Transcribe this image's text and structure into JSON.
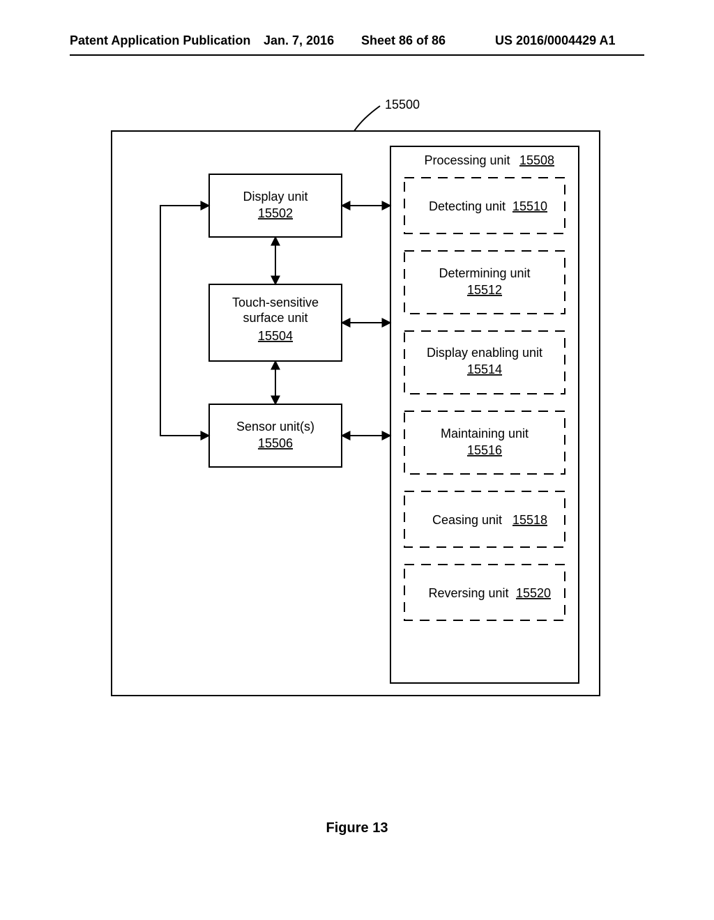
{
  "header": {
    "left": "Patent Application Publication",
    "date": "Jan. 7, 2016",
    "sheet": "Sheet 86 of 86",
    "pubno": "US 2016/0004429 A1"
  },
  "figure_label": "Figure 13",
  "device_ref": "15500",
  "left_units": {
    "display": {
      "label": "Display unit",
      "ref": "15502"
    },
    "touch": {
      "label1": "Touch-sensitive",
      "label2": "surface unit",
      "ref": "15504"
    },
    "sensor": {
      "label": "Sensor unit(s)",
      "ref": "15506"
    }
  },
  "processing": {
    "label": "Processing unit",
    "ref": "15508",
    "subs": {
      "detect": {
        "label": "Detecting unit",
        "ref": "15510"
      },
      "determine": {
        "label": "Determining unit",
        "ref": "15512"
      },
      "dispenab": {
        "label": "Display enabling unit",
        "ref": "15514"
      },
      "maintain": {
        "label": "Maintaining unit",
        "ref": "15516"
      },
      "cease": {
        "label": "Ceasing unit",
        "ref": "15518"
      },
      "reverse": {
        "label": "Reversing unit",
        "ref": "15520"
      }
    }
  }
}
